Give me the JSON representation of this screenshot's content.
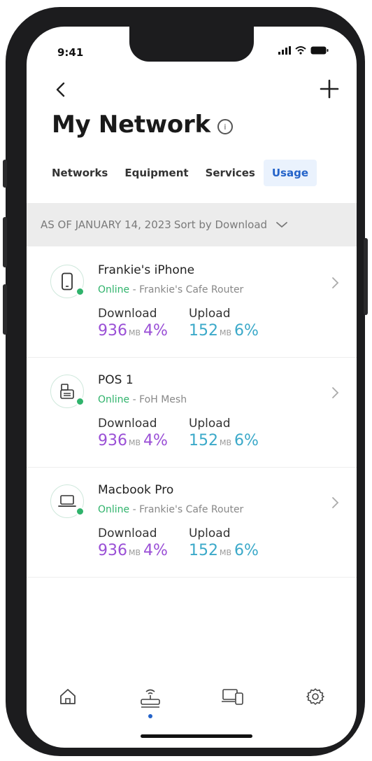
{
  "status": {
    "time": "9:41"
  },
  "header": {
    "title": "My Network",
    "info_symbol": "i"
  },
  "tabs": [
    {
      "label": "Networks",
      "active": false
    },
    {
      "label": "Equipment",
      "active": false
    },
    {
      "label": "Services",
      "active": false
    },
    {
      "label": "Usage",
      "active": true
    }
  ],
  "filter": {
    "as_of": "AS OF JANUARY 14, 2023",
    "sort_label": "Sort by Download"
  },
  "devices": [
    {
      "name": "Frankie's iPhone",
      "status": "Online",
      "location": " - Frankie's Cafe Router",
      "icon": "phone-icon",
      "download_label": "Download",
      "download_value": "936",
      "download_unit": "MB",
      "download_pct": "4%",
      "upload_label": "Upload",
      "upload_value": "152",
      "upload_unit": "MB",
      "upload_pct": "6%"
    },
    {
      "name": "POS 1",
      "status": "Online",
      "location": " - FoH Mesh",
      "icon": "pos-terminal-icon",
      "download_label": "Download",
      "download_value": "936",
      "download_unit": "MB",
      "download_pct": "4%",
      "upload_label": "Upload",
      "upload_value": "152",
      "upload_unit": "MB",
      "upload_pct": "6%"
    },
    {
      "name": "Macbook Pro",
      "status": "Online",
      "location": " - Frankie's Cafe Router",
      "icon": "laptop-icon",
      "download_label": "Download",
      "download_value": "936",
      "download_unit": "MB",
      "download_pct": "4%",
      "upload_label": "Upload",
      "upload_value": "152",
      "upload_unit": "MB",
      "upload_pct": "6%"
    }
  ],
  "nav": [
    {
      "icon": "home-icon",
      "active": false
    },
    {
      "icon": "router-icon",
      "active": true
    },
    {
      "icon": "devices-icon",
      "active": false
    },
    {
      "icon": "settings-gear-icon",
      "active": false
    }
  ],
  "colors": {
    "accent": "#2463c9",
    "online": "#2fb36b",
    "download": "#9a4fd6",
    "upload": "#3ba9c9"
  }
}
